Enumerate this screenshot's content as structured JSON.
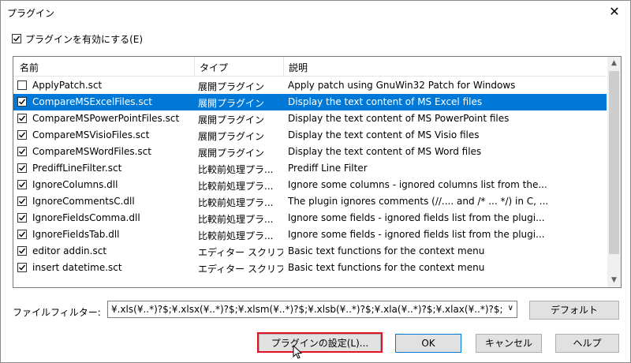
{
  "window": {
    "title": "プラグイン"
  },
  "enable_plugins": {
    "label": "プラグインを有効にする(E)",
    "checked": true
  },
  "list": {
    "headers": [
      "名前",
      "タイプ",
      "説明"
    ],
    "selected_index": 1,
    "rows": [
      {
        "name": "ApplyPatch.sct",
        "type": "展開プラグイン",
        "desc": "Apply patch using GnuWin32 Patch for Windows",
        "checked": false
      },
      {
        "name": "CompareMSExcelFiles.sct",
        "type": "展開プラグイン",
        "desc": "Display the text content of MS Excel files",
        "checked": true
      },
      {
        "name": "CompareMSPowerPointFiles.sct",
        "type": "展開プラグイン",
        "desc": "Display the text content of MS PowerPoint files",
        "checked": true
      },
      {
        "name": "CompareMSVisioFiles.sct",
        "type": "展開プラグイン",
        "desc": "Display the text content of MS Visio files",
        "checked": true
      },
      {
        "name": "CompareMSWordFiles.sct",
        "type": "展開プラグイン",
        "desc": "Display the text content of MS Word files",
        "checked": true
      },
      {
        "name": "PrediffLineFilter.sct",
        "type": "比較前処理プラ...",
        "desc": "Prediff Line Filter",
        "checked": true
      },
      {
        "name": "IgnoreColumns.dll",
        "type": "比較前処理プラ...",
        "desc": "Ignore some columns - ignored columns list from the...",
        "checked": true
      },
      {
        "name": "IgnoreCommentsC.dll",
        "type": "比較前処理プラ...",
        "desc": "The plugin ignores comments (//.... and /* ... */) in C, ...",
        "checked": true
      },
      {
        "name": "IgnoreFieldsComma.dll",
        "type": "比較前処理プラ...",
        "desc": "Ignore some fields - ignored fields list from the plugi...",
        "checked": true
      },
      {
        "name": "IgnoreFieldsTab.dll",
        "type": "比較前処理プラ...",
        "desc": "Ignore some fields - ignored fields list from the plugi...",
        "checked": true
      },
      {
        "name": "editor addin.sct",
        "type": "エディター スクリプト",
        "desc": "Basic text functions for the context menu",
        "checked": true
      },
      {
        "name": "insert datetime.sct",
        "type": "エディター スクリプト",
        "desc": "Basic text functions for the context menu",
        "checked": true
      }
    ]
  },
  "filter": {
    "label": "ファイルフィルター:",
    "value": "¥.xls(¥..*)?$;¥.xlsx(¥..*)?$;¥.xlsm(¥..*)?$;¥.xlsb(¥..*)?$;¥.xla(¥..*)?$;¥.xlax(¥..*)?$;¥.xltx(¥"
  },
  "buttons": {
    "default": "デフォルト",
    "plugin_settings": "プラグインの設定(L)...",
    "ok": "OK",
    "cancel": "キャンセル",
    "help": "ヘルプ"
  },
  "colors": {
    "selection": "#0078d7",
    "highlight_box": "#e81123"
  }
}
